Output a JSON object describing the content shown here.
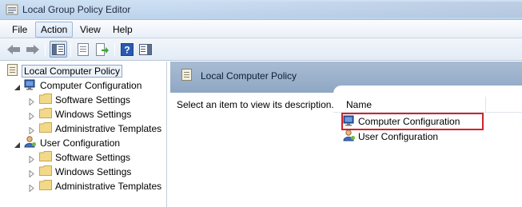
{
  "window": {
    "title": "Local Group Policy Editor"
  },
  "menu": [
    "File",
    "Action",
    "View",
    "Help"
  ],
  "toolbar": {
    "buttons": [
      "back-arrow-icon",
      "forward-arrow-icon",
      "show-hide-tree-icon",
      "properties-icon",
      "export-list-icon",
      "help-icon",
      "show-action-pane-icon"
    ]
  },
  "tree": {
    "root": "Local Computer Policy",
    "computer": {
      "label": "Computer Configuration",
      "children": [
        "Software Settings",
        "Windows Settings",
        "Administrative Templates"
      ]
    },
    "user": {
      "label": "User Configuration",
      "children": [
        "Software Settings",
        "Windows Settings",
        "Administrative Templates"
      ]
    }
  },
  "right": {
    "header": "Local Computer Policy",
    "description": "Select an item to view its description.",
    "column": "Name",
    "items": [
      "Computer Configuration",
      "User Configuration"
    ]
  },
  "colors": {
    "highlight_border": "#d0232a",
    "header_bg": "#9fb3cd"
  }
}
